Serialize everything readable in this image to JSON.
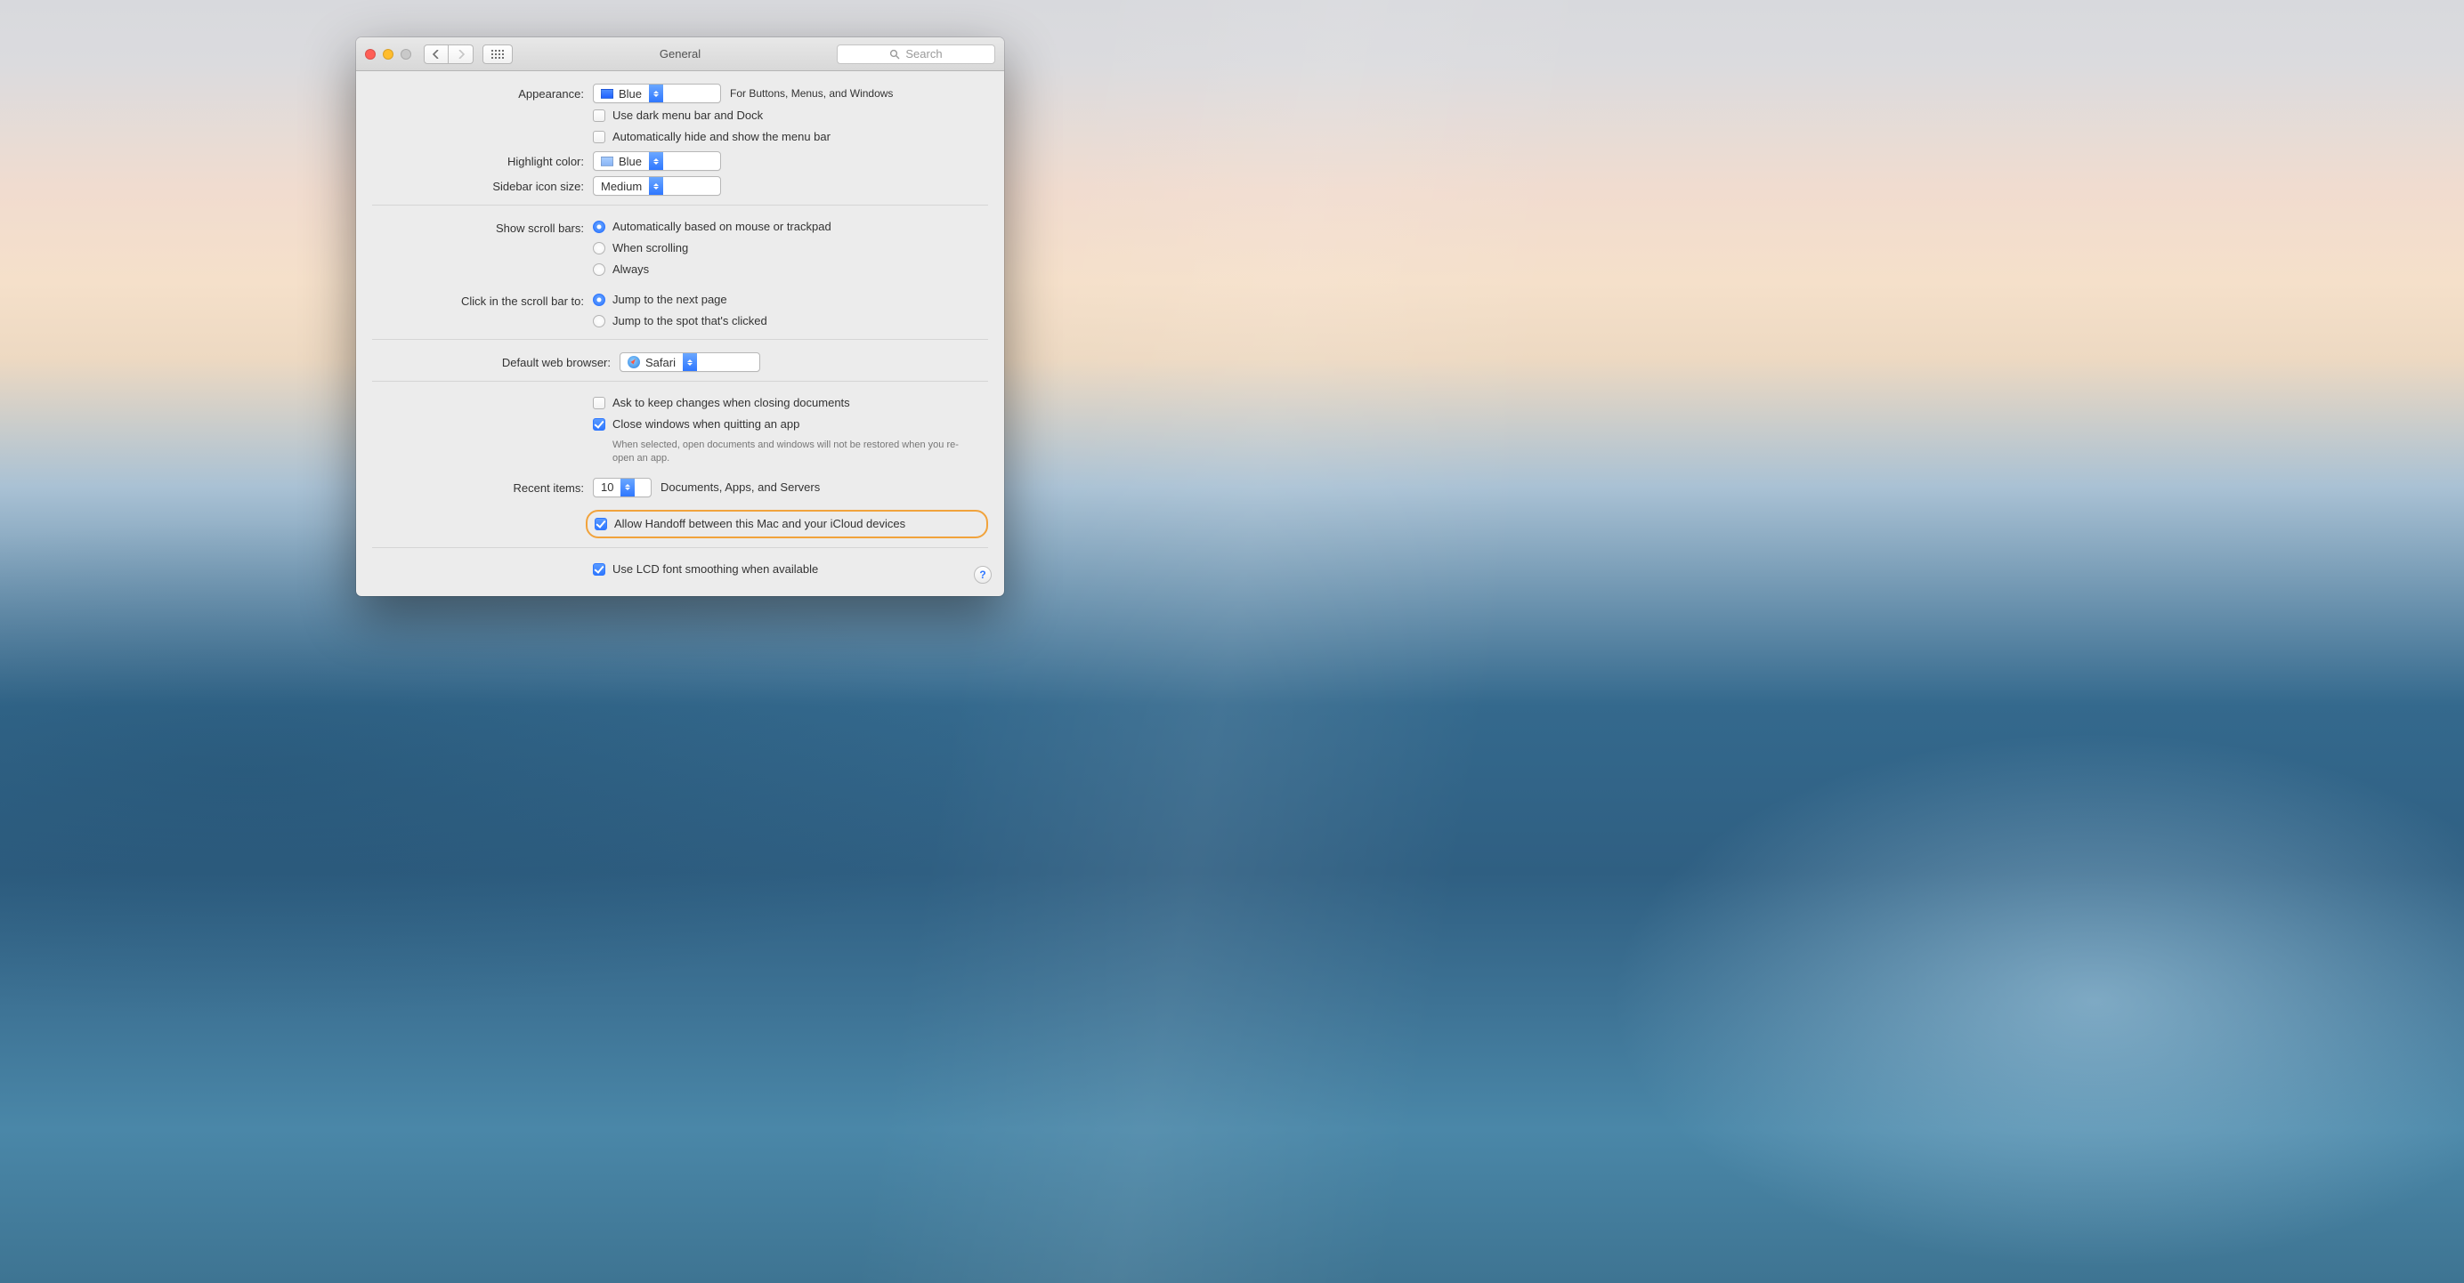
{
  "titlebar": {
    "title": "General",
    "search_placeholder": "Search"
  },
  "appearance": {
    "label": "Appearance:",
    "value": "Blue",
    "hint": "For Buttons, Menus, and Windows",
    "dark_menu": {
      "label": "Use dark menu bar and Dock",
      "checked": false
    },
    "auto_hide": {
      "label": "Automatically hide and show the menu bar",
      "checked": false
    }
  },
  "highlight": {
    "label": "Highlight color:",
    "value": "Blue"
  },
  "sidebar": {
    "label": "Sidebar icon size:",
    "value": "Medium"
  },
  "scrollbars": {
    "label": "Show scroll bars:",
    "options": [
      {
        "label": "Automatically based on mouse or trackpad",
        "selected": true
      },
      {
        "label": "When scrolling",
        "selected": false
      },
      {
        "label": "Always",
        "selected": false
      }
    ]
  },
  "clickbar": {
    "label": "Click in the scroll bar to:",
    "options": [
      {
        "label": "Jump to the next page",
        "selected": true
      },
      {
        "label": "Jump to the spot that's clicked",
        "selected": false
      }
    ]
  },
  "browser": {
    "label": "Default web browser:",
    "value": "Safari"
  },
  "documents": {
    "ask": {
      "label": "Ask to keep changes when closing documents",
      "checked": false
    },
    "close": {
      "label": "Close windows when quitting an app",
      "checked": true
    },
    "note": "When selected, open documents and windows will not be restored when you re-open an app."
  },
  "recent": {
    "label": "Recent items:",
    "value": "10",
    "suffix": "Documents, Apps, and Servers"
  },
  "handoff": {
    "label": "Allow Handoff between this Mac and your iCloud devices",
    "checked": true
  },
  "lcd": {
    "label": "Use LCD font smoothing when available",
    "checked": true
  },
  "help": "?"
}
